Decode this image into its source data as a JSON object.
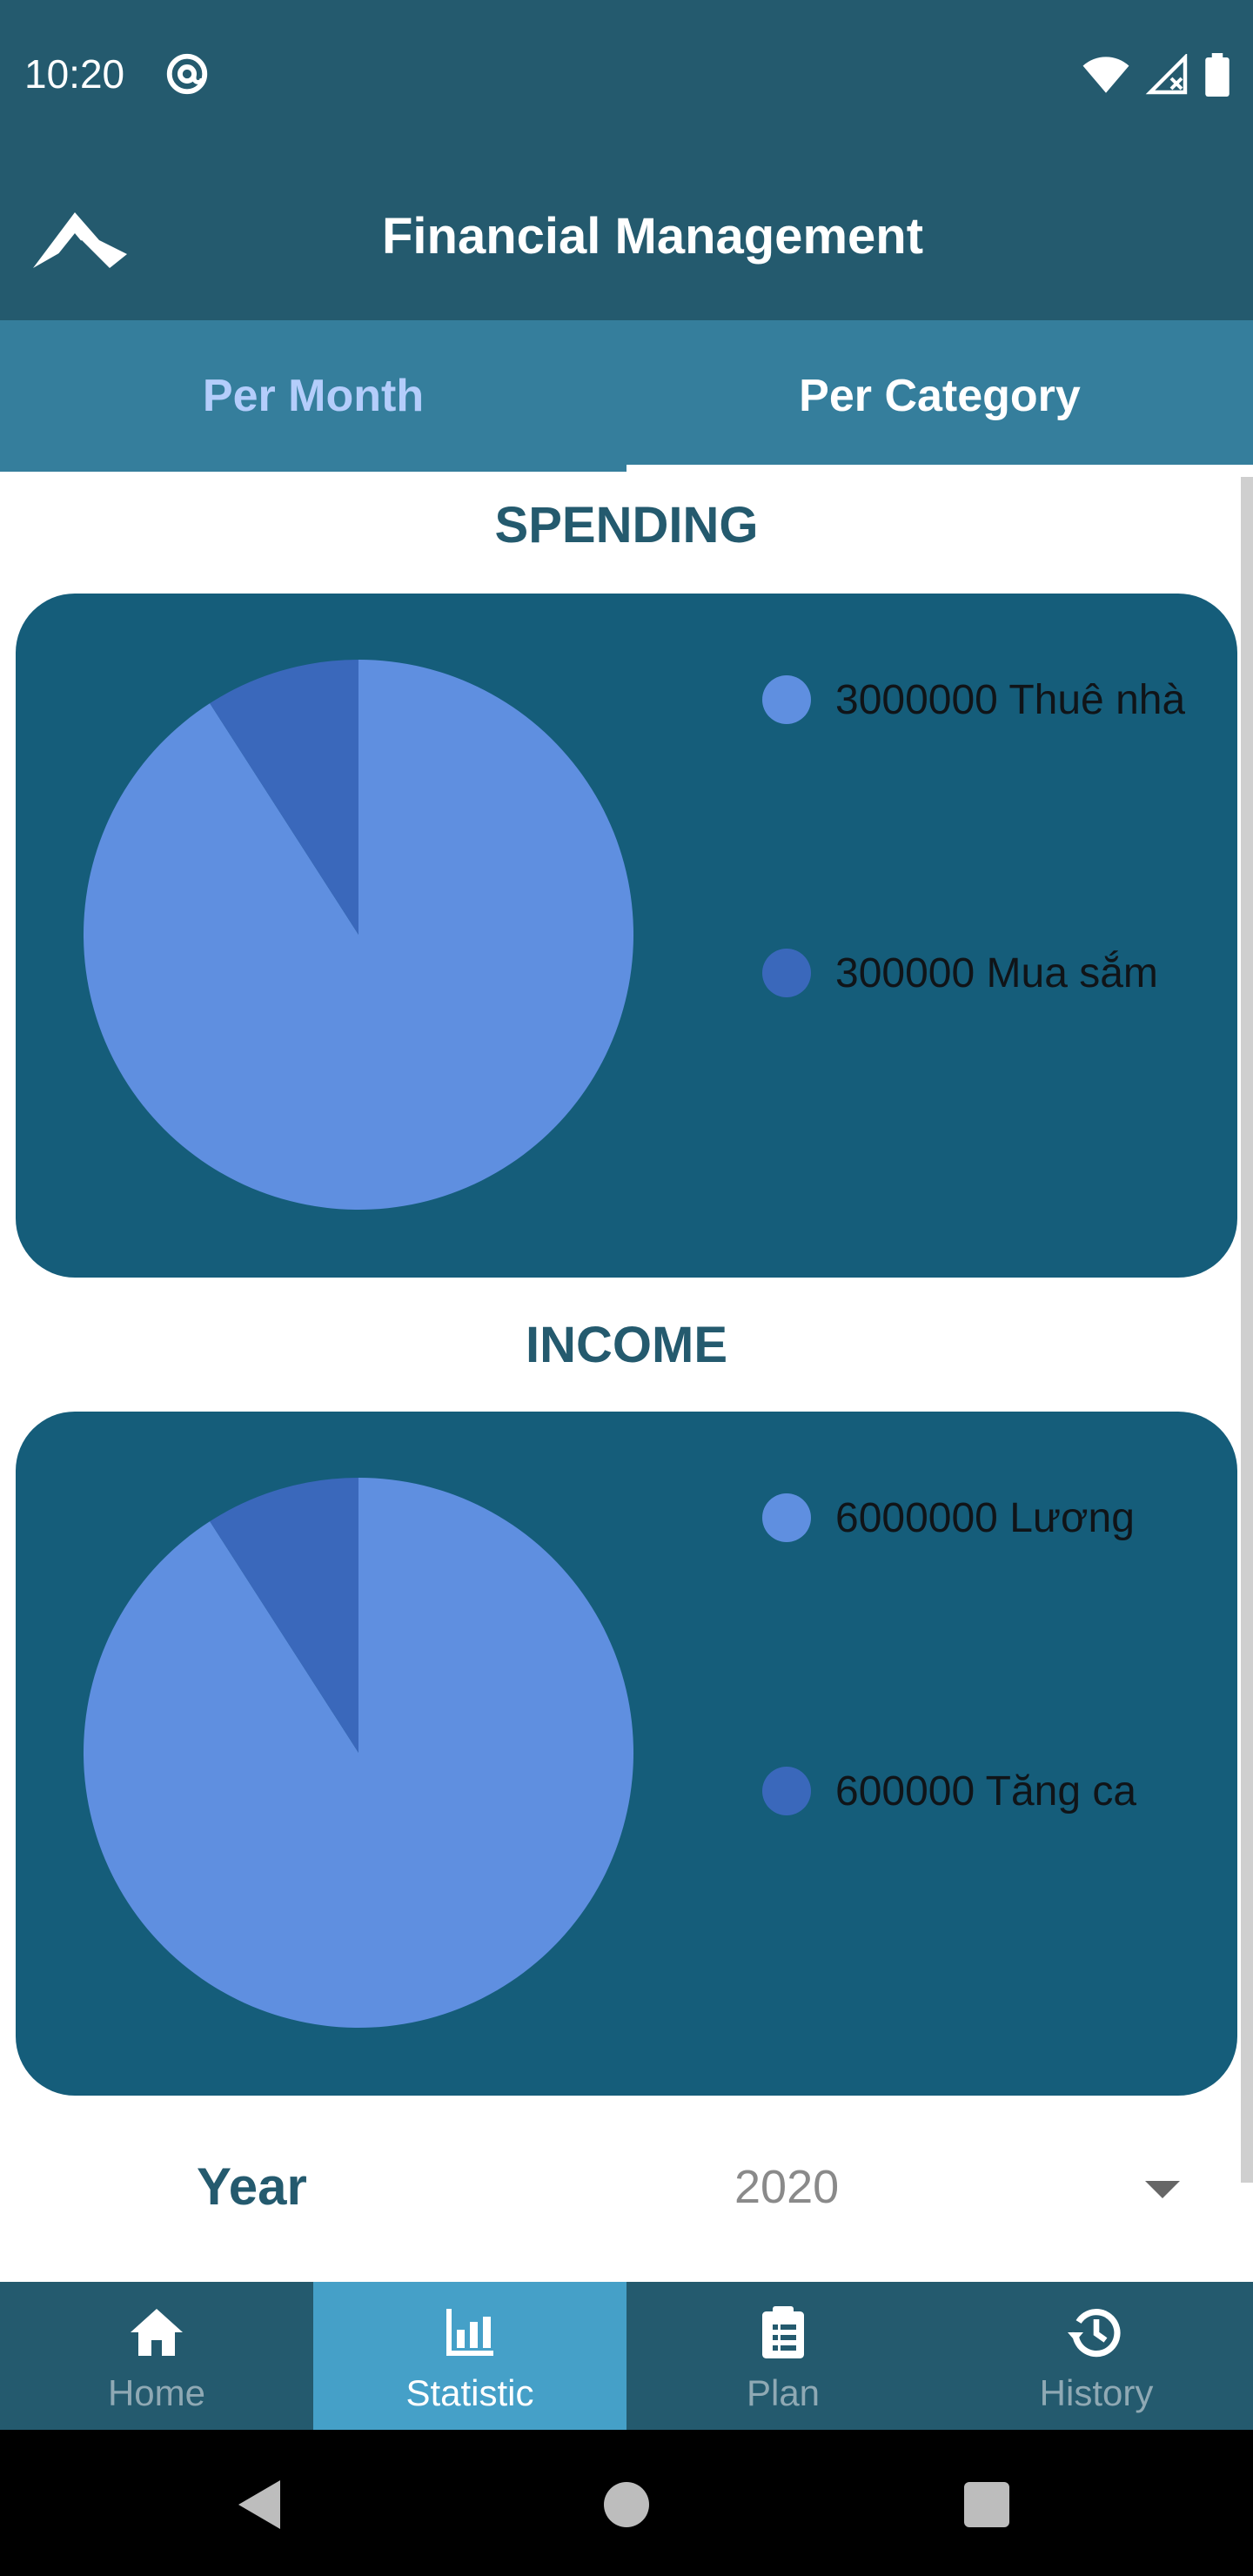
{
  "status_bar": {
    "time": "10:20",
    "icons": [
      "at-sign-icon",
      "wifi-icon",
      "signal-icon",
      "battery-icon"
    ]
  },
  "app_bar": {
    "title": "Financial Management",
    "logo_icon": "app-logo-icon"
  },
  "tabs": [
    {
      "label": "Per Month",
      "active": false
    },
    {
      "label": "Per Category",
      "active": true
    }
  ],
  "spending": {
    "title": "SPENDING",
    "legend": [
      {
        "label": "3000000 Thuê nhà",
        "color": "#5f8fe0"
      },
      {
        "label": "300000 Mua sắm",
        "color": "#3a68bb"
      }
    ]
  },
  "income": {
    "title": "INCOME",
    "legend": [
      {
        "label": "6000000 Lương",
        "color": "#5f8fe0"
      },
      {
        "label": "600000 Tăng ca",
        "color": "#3a68bb"
      }
    ]
  },
  "chart_data": [
    {
      "type": "pie",
      "title": "SPENDING",
      "categories": [
        "Thuê nhà",
        "Mua sắm"
      ],
      "values": [
        3000000,
        300000
      ],
      "colors": [
        "#5f8fe0",
        "#3a68bb"
      ],
      "legend_position": "right"
    },
    {
      "type": "pie",
      "title": "INCOME",
      "categories": [
        "Lương",
        "Tăng ca"
      ],
      "values": [
        6000000,
        600000
      ],
      "colors": [
        "#5f8fe0",
        "#3a68bb"
      ],
      "legend_position": "right"
    }
  ],
  "year_selector": {
    "label": "Year",
    "value": "2020"
  },
  "bottom_nav": [
    {
      "label": "Home",
      "icon": "home-icon",
      "active": false
    },
    {
      "label": "Statistic",
      "icon": "bar-chart-icon",
      "active": true
    },
    {
      "label": "Plan",
      "icon": "clipboard-icon",
      "active": false
    },
    {
      "label": "History",
      "icon": "history-icon",
      "active": false
    }
  ],
  "colors": {
    "primary_dark": "#245a6e",
    "tab_bar": "#357e9c",
    "card": "#155d7a",
    "nav_active": "#45a0c8",
    "slice_light": "#5f8fe0",
    "slice_dark": "#3a68bb"
  }
}
